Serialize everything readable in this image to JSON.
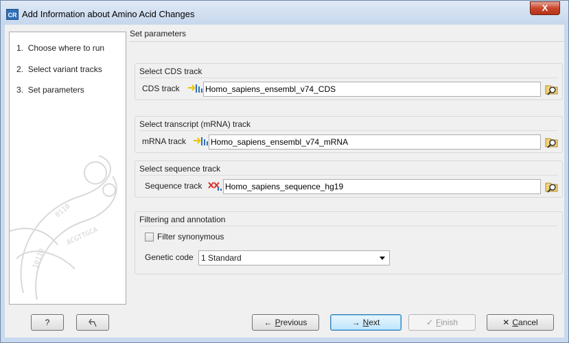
{
  "window": {
    "title": "Add Information about Amino Acid Changes",
    "app_icon_text": "CR",
    "close_label": "X"
  },
  "steps": [
    {
      "number": "1.",
      "label": "Choose where to run"
    },
    {
      "number": "2.",
      "label": "Select variant tracks"
    },
    {
      "number": "3.",
      "label": "Set parameters"
    }
  ],
  "content": {
    "title": "Set parameters",
    "cds": {
      "group_title": "Select CDS track",
      "label": "CDS track",
      "value": "Homo_sapiens_ensembl_v74_CDS",
      "icon": "cds-track-icon"
    },
    "mrna": {
      "group_title": "Select transcript (mRNA) track",
      "label": "mRNA track",
      "value": "Homo_sapiens_ensembl_v74_mRNA",
      "icon": "mrna-track-icon"
    },
    "sequence": {
      "group_title": "Select sequence track",
      "label": "Sequence track",
      "value": "Homo_sapiens_sequence_hg19",
      "icon": "sequence-track-icon"
    },
    "filtering": {
      "group_title": "Filtering and annotation",
      "filter_synonymous_label": "Filter synonymous",
      "filter_synonymous_checked": false,
      "genetic_code_label": "Genetic code",
      "genetic_code_value": "1 Standard"
    }
  },
  "buttons": {
    "help": "?",
    "previous": {
      "glyph": "←",
      "pre": "",
      "u": "P",
      "post": "revious"
    },
    "next": {
      "glyph": "→",
      "pre": "",
      "u": "N",
      "post": "ext"
    },
    "finish": {
      "glyph": "✓",
      "pre": "",
      "u": "F",
      "post": "inish"
    },
    "cancel": {
      "glyph": "✕",
      "pre": "",
      "u": "C",
      "post": "ancel"
    }
  },
  "colors": {
    "accent": "#3c7fb1",
    "close": "#c8462c",
    "track_icon_yellow": "#e7c400",
    "sequence_icon_red": "#d2322d"
  }
}
